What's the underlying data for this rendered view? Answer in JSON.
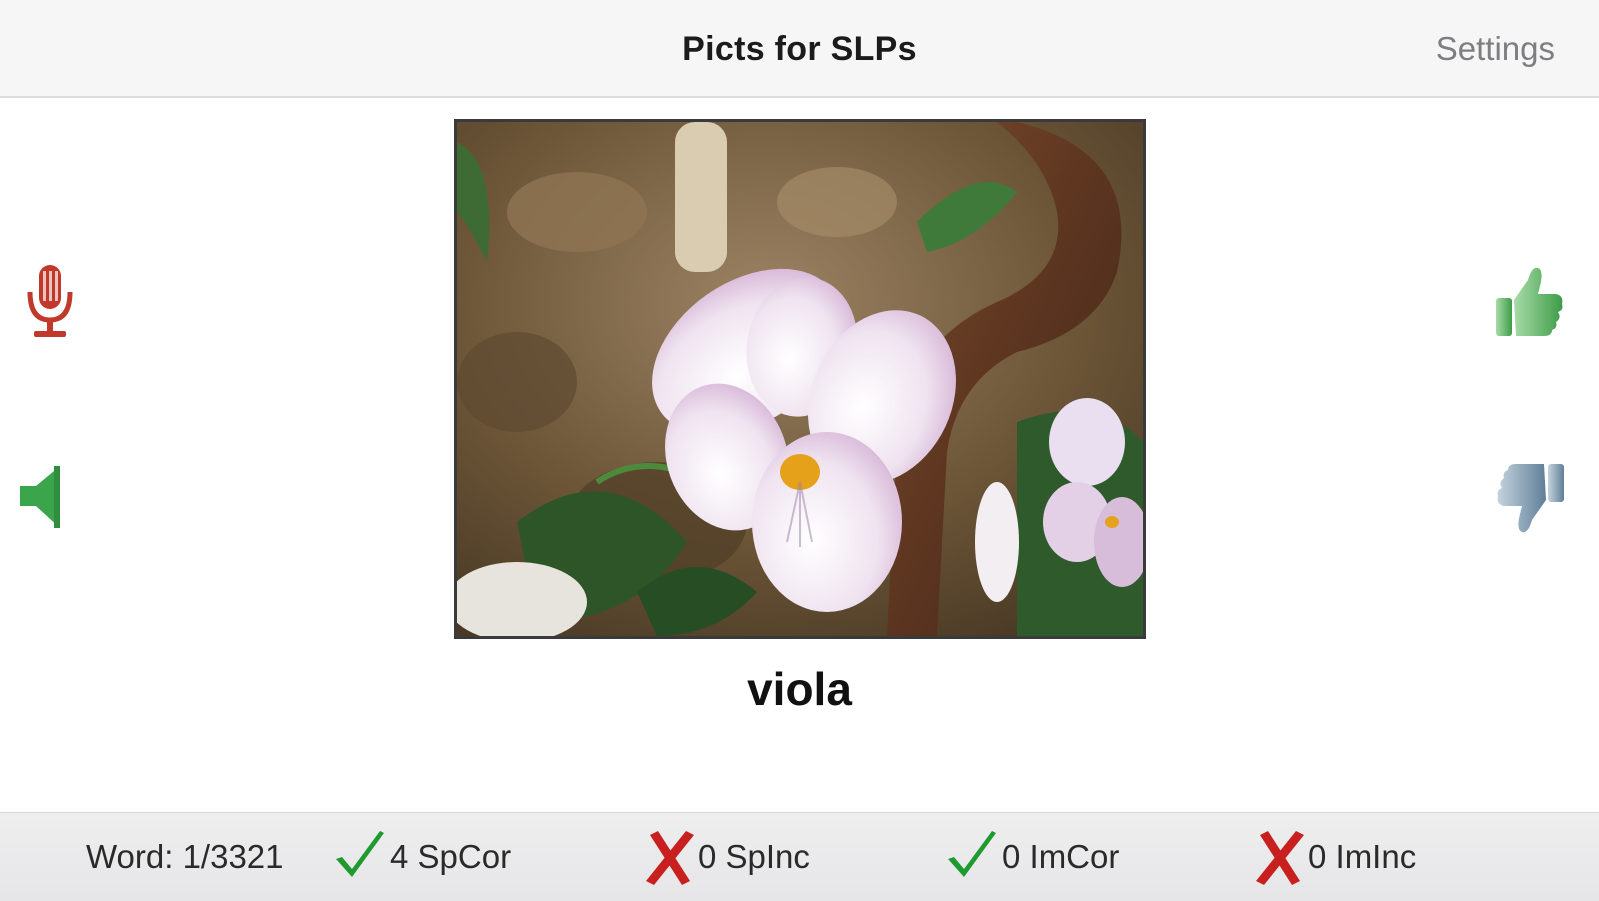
{
  "nav": {
    "title": "Picts for SLPs",
    "settings_label": "Settings"
  },
  "controls": {
    "record_icon": "microphone-icon",
    "speaker_icon": "speaker-icon",
    "correct_icon": "thumbs-up-icon",
    "incorrect_icon": "thumbs-down-icon"
  },
  "card": {
    "image": "viola flower photo",
    "word": "viola"
  },
  "status": {
    "word_count": "Word: 1/3321",
    "sp_correct": "4 SpCor",
    "sp_incorrect": "0 SpInc",
    "im_correct": "0 ImCor",
    "im_incorrect": "0 ImInc"
  },
  "colors": {
    "mic_red": "#c0392b",
    "speaker_green": "#3aa54a",
    "thumb_up_green": "#4caf50",
    "thumb_down_blue": "#6b8ba4",
    "check_green": "#1f9a2e",
    "cross_red": "#c8201f"
  }
}
